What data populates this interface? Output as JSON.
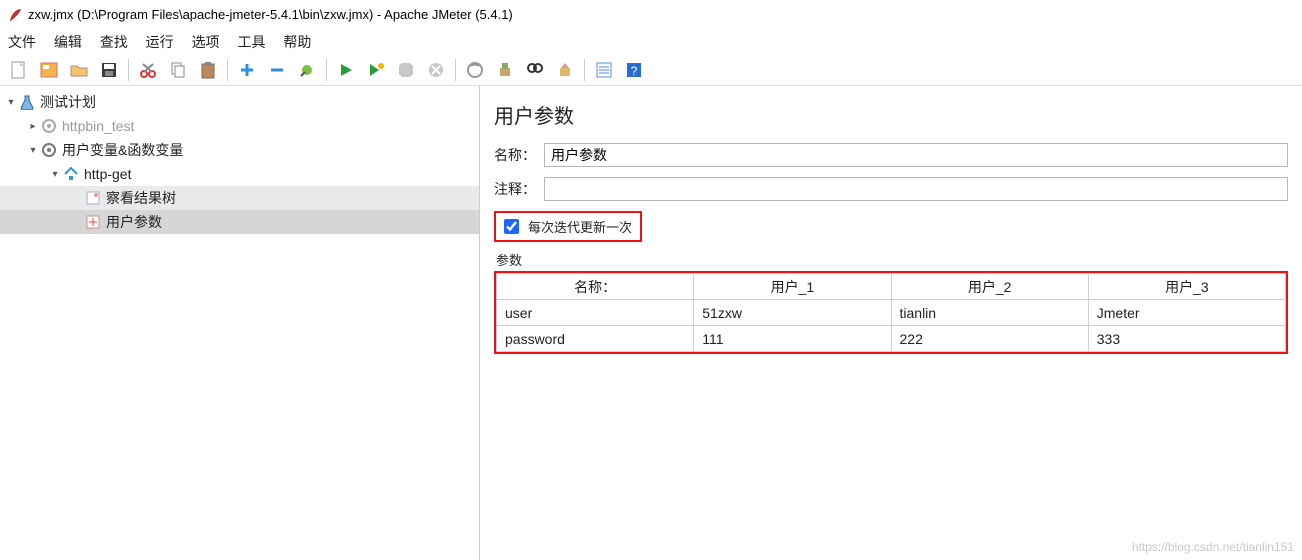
{
  "window": {
    "title": "zxw.jmx (D:\\Program Files\\apache-jmeter-5.4.1\\bin\\zxw.jmx) - Apache JMeter (5.4.1)"
  },
  "menu": {
    "file": "文件",
    "edit": "编辑",
    "search": "查找",
    "run": "运行",
    "options": "选项",
    "tools": "工具",
    "help": "帮助"
  },
  "tree": {
    "root": "测试计划",
    "node1": "httpbin_test",
    "node2": "用户变量&函数变量",
    "node3": "http-get",
    "node4": "察看结果树",
    "node5": "用户参数"
  },
  "panel": {
    "heading": "用户参数",
    "name_label": "名称：",
    "name_value": "用户参数",
    "comment_label": "注释：",
    "comment_value": "",
    "checkbox_label": "每次迭代更新一次",
    "checkbox_checked": true,
    "params_label": "参数",
    "table": {
      "headers": [
        "名称：",
        "用户_1",
        "用户_2",
        "用户_3"
      ],
      "rows": [
        [
          "user",
          "51zxw",
          "tianlin",
          "Jmeter"
        ],
        [
          "password",
          "111",
          "222",
          "333"
        ]
      ]
    }
  },
  "watermark": "https://blog.csdn.net/tianlin151"
}
